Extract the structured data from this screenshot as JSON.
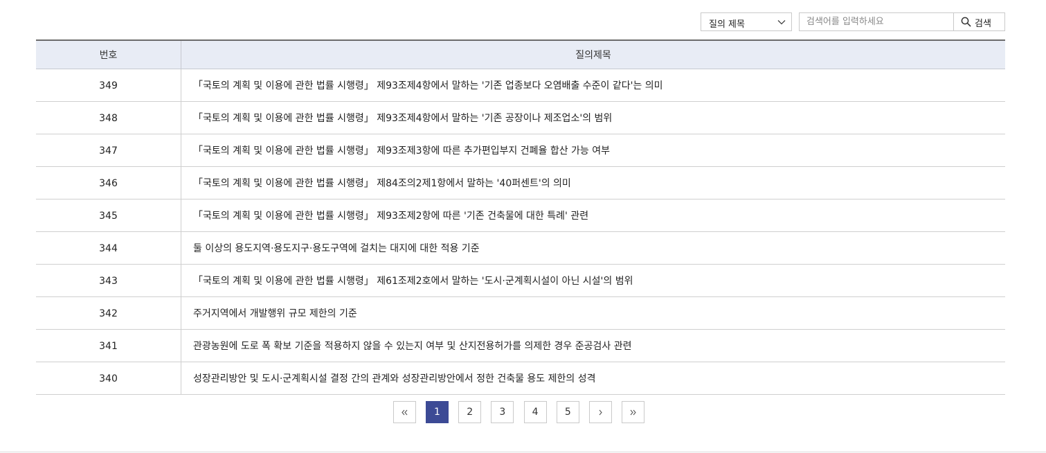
{
  "search": {
    "select_value": "질의 제목",
    "placeholder": "검색어를 입력하세요",
    "button_label": "검색"
  },
  "table": {
    "headers": [
      "번호",
      "질의제목"
    ],
    "rows": [
      {
        "no": "349",
        "title": "「국토의 계획 및 이용에 관한 법률 시행령」 제93조제4항에서 말하는 '기존 업종보다 오염배출 수준이 같다'는 의미"
      },
      {
        "no": "348",
        "title": "「국토의 계획 및 이용에 관한 법률 시행령」 제93조제4항에서 말하는 '기존 공장이나 제조업소'의 범위"
      },
      {
        "no": "347",
        "title": "「국토의 계획 및 이용에 관한 법률 시행령」 제93조제3항에 따른 추가편입부지 건폐율 합산 가능 여부"
      },
      {
        "no": "346",
        "title": "「국토의 계획 및 이용에 관한 법률 시행령」 제84조의2제1항에서 말하는 '40퍼센트'의 의미"
      },
      {
        "no": "345",
        "title": "「국토의 계획 및 이용에 관한 법률 시행령」 제93조제2항에 따른 '기존 건축물에 대한 특례' 관련"
      },
      {
        "no": "344",
        "title": "둘 이상의 용도지역·용도지구·용도구역에 걸치는 대지에 대한 적용 기준"
      },
      {
        "no": "343",
        "title": "「국토의 계획 및 이용에 관한 법률 시행령」 제61조제2호에서 말하는 '도시·군계획시설이 아닌 시설'의 범위"
      },
      {
        "no": "342",
        "title": "주거지역에서 개발행위 규모 제한의 기준"
      },
      {
        "no": "341",
        "title": "관광농원에 도로 폭 확보 기준을 적용하지 않을 수 있는지 여부 및 산지전용허가를 의제한 경우 준공검사 관련"
      },
      {
        "no": "340",
        "title": "성장관리방안 및 도시·군계획시설 결정 간의 관계와 성장관리방안에서 정한 건축물 용도 제한의 성격"
      }
    ]
  },
  "pagination": {
    "pages": [
      "1",
      "2",
      "3",
      "4",
      "5"
    ],
    "current": "1"
  }
}
